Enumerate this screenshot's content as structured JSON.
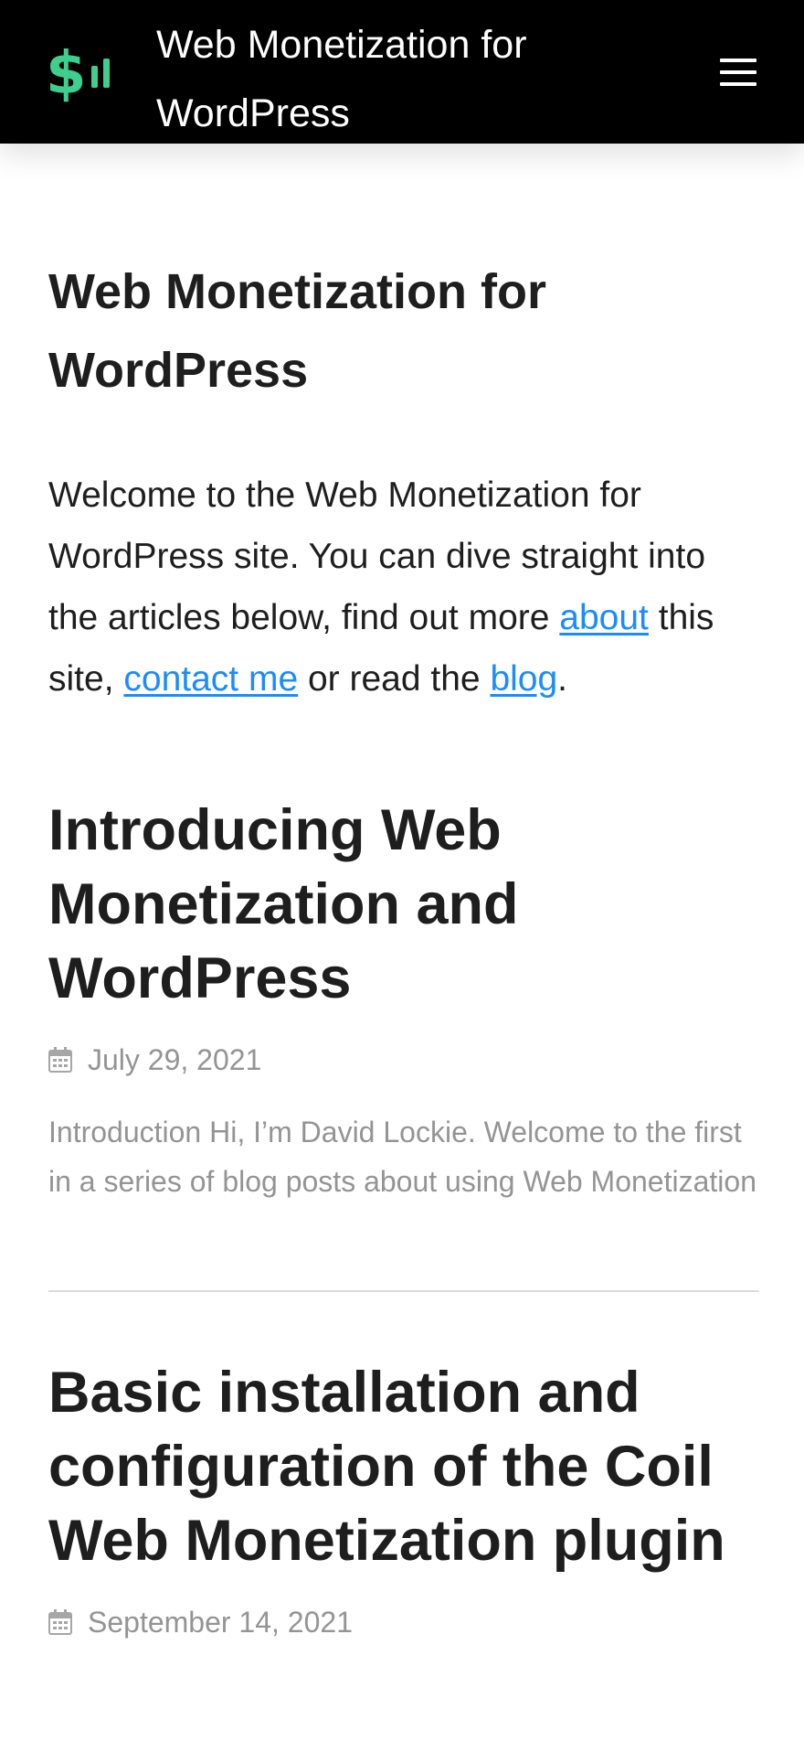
{
  "header": {
    "site_title": "Web Monetization for WordPress",
    "menu_icon": "hamburger-menu-icon",
    "logo_icon": "dollar-signal-logo-icon",
    "accent_color": "#3ecf8e"
  },
  "page": {
    "title": "Web Monetization for WordPress",
    "intro": {
      "p1": "Welcome to the Web Monetization for WordPress site. You can dive straight into the articles below, find out more ",
      "link_about": "about",
      "p2": " this site, ",
      "link_contact": "contact me",
      "p3": " or read the ",
      "link_blog": "blog",
      "p4": "."
    }
  },
  "posts": [
    {
      "title": "Introducing Web Monetization and WordPress",
      "date": "July 29, 2021",
      "excerpt": "Introduction Hi, I’m David Lockie. Welcome to the first in a series of blog posts about using Web Monetization"
    },
    {
      "title": "Basic installation and configuration of the Coil Web Monetization plugin",
      "date": "September 14, 2021"
    }
  ],
  "colors": {
    "link": "#1a8cff",
    "meta_text": "#949494",
    "header_bg": "#000000"
  }
}
